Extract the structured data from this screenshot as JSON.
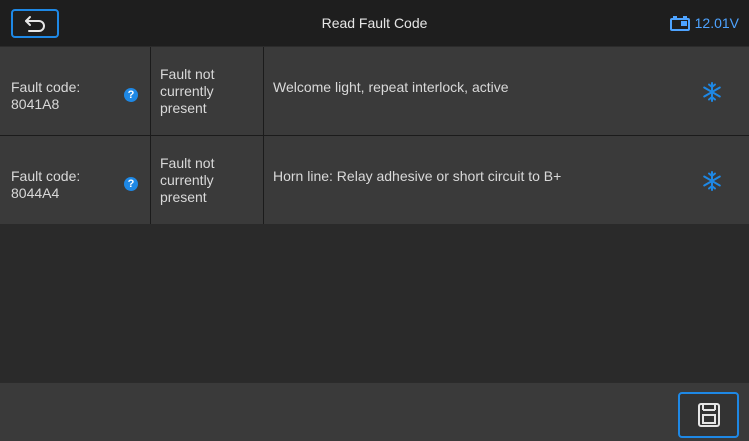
{
  "header": {
    "title": "Read Fault Code",
    "battery_voltage": "12.01V"
  },
  "faults": [
    {
      "code": "Fault code:\n8041A8",
      "status": "Fault not\ncurrently\npresent",
      "description": "Welcome light, repeat interlock, active"
    },
    {
      "code": "Fault code:\n8044A4",
      "status": "Fault not\ncurrently\npresent",
      "description": "Horn line: Relay adhesive or short circuit to B+"
    }
  ],
  "icons": {
    "back": "back-arrow-icon",
    "battery": "car-battery-icon",
    "help": "question-mark-icon",
    "freeze_frame": "snowflake-icon",
    "save": "floppy-disk-icon"
  },
  "colors": {
    "accent": "#1e88e5",
    "background": "#2b2b2b",
    "row": "#3a3a3a",
    "header": "#1e1e1e"
  }
}
